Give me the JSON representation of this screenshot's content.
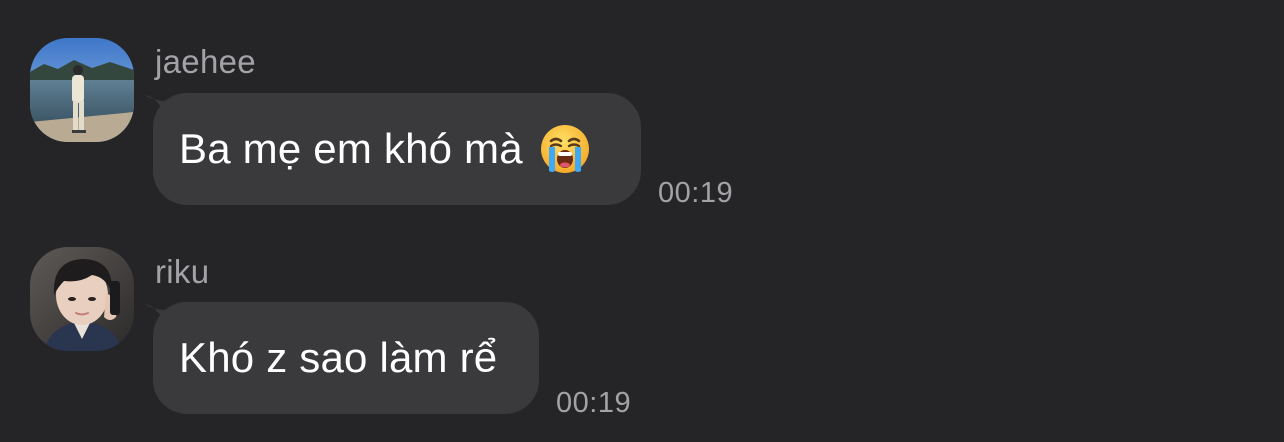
{
  "messages": [
    {
      "sender": "jaehee",
      "text": "Ba mẹ em khó mà",
      "emoji": "loudly-crying-face-icon",
      "time": "00:19",
      "avatar": "jaehee-avatar"
    },
    {
      "sender": "riku",
      "text": "Khó z sao làm rể",
      "time": "00:19",
      "avatar": "riku-avatar"
    }
  ],
  "colors": {
    "background": "#252527",
    "bubble": "#3a3a3c",
    "meta_text": "#a3a3a7",
    "message_text": "#ffffff"
  }
}
